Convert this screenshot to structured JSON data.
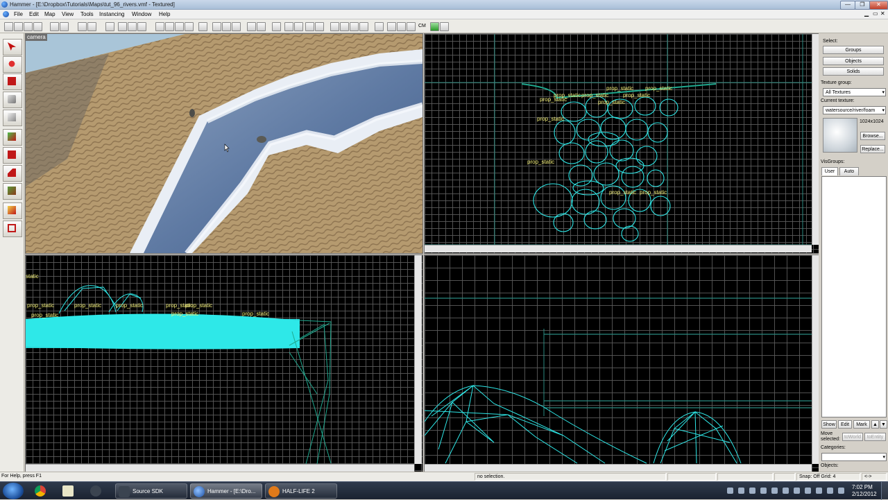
{
  "window": {
    "title": "Hammer - [E:\\Dropbox\\Tutorials\\Maps\\tut_96_rivers.vmf - Textured]",
    "controls": [
      "—",
      "❐",
      "✕"
    ]
  },
  "menu": [
    "File",
    "Edit",
    "Map",
    "View",
    "Tools",
    "Instancing",
    "Window",
    "Help"
  ],
  "toolbar": {
    "cm_label": "CM"
  },
  "viewports": {
    "camera_label": "camera",
    "top_labels": [
      "prop_static",
      "prop_static",
      "prop_static",
      "prop_static",
      "prop_static",
      "prop_static",
      "prop_static",
      "prop_static",
      "prop_static",
      "prop_static",
      "prop_static"
    ],
    "front_labels": [
      "static",
      "prop_static",
      "prop_static",
      "prop_static",
      "prop_static",
      "prop_static",
      "prop_static",
      "prop_static",
      "prop_static"
    ]
  },
  "panel": {
    "select_label": "Select:",
    "groups_btn": "Groups",
    "objects_btn": "Objects",
    "solids_btn": "Solids",
    "texture_group_label": "Texture group:",
    "texture_group_value": "All Textures",
    "current_texture_label": "Current texture:",
    "current_texture_value": "watersource/river/foam",
    "texture_size": "1024x1024",
    "browse_btn": "Browse...",
    "replace_btn": "Replace...",
    "visgroups_label": "VisGroups:",
    "tab_user": "User",
    "tab_auto": "Auto",
    "show_btn": "Show",
    "edit_btn": "Edit",
    "mark_btn": "Mark",
    "move_selected_label": "Move selected:",
    "to_world_btn": "toWorld",
    "to_entity_btn": "toEntity",
    "categories_label": "Categories:",
    "objects_label": "Objects:"
  },
  "status": {
    "help": "For Help, press F1",
    "selection": "no selection.",
    "snap": "Snap: Off Grid: 4",
    "arrows": "<->"
  },
  "taskbar": {
    "tasks": [
      {
        "label": "Source SDK",
        "icon": "steam-icon"
      },
      {
        "label": "Hammer - [E:\\Dro...",
        "icon": "hammer-icon"
      },
      {
        "label": "HALF-LIFE 2",
        "icon": "lambda-icon"
      }
    ],
    "time": "7:02 PM",
    "date": "2/12/2012"
  },
  "colors": {
    "wire": "#2ee8e8",
    "label": "#f6f27a",
    "grid": "#5a5a5a",
    "accent_line": "#2a8a80"
  }
}
